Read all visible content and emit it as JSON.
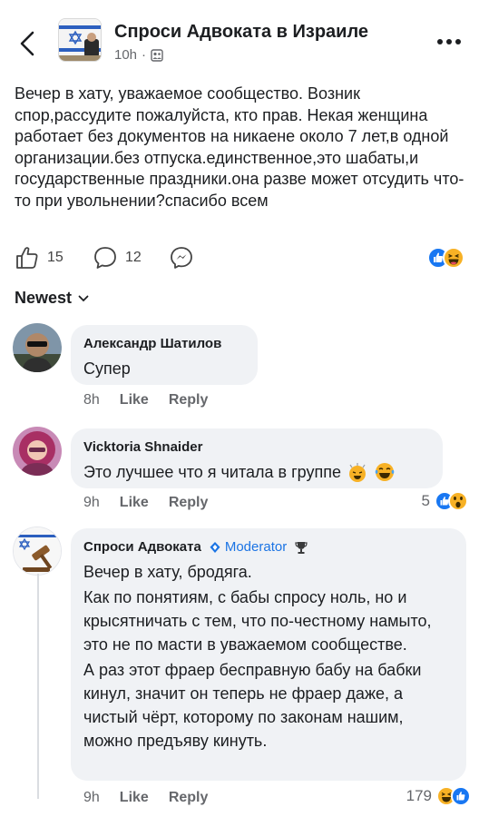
{
  "header": {
    "group_name": "Спроси Адвоката в Израиле",
    "time": "10h",
    "separator": "·",
    "back_icon": "chevron-left-icon",
    "more_icon": "more-horizontal-icon"
  },
  "post": {
    "text": "Вечер в хату, уважаемое сообщество. Возник спор,рассудите пожалуйста, кто прав. Некая женщина работает без документов на никаене около 7 лет,в одной организации.без отпуска.единственное,это шабаты,и государственные праздники.она разве может отсудить что-то при увольнении?спасибо всем",
    "likes": "15",
    "comments": "12"
  },
  "sort": {
    "label": "Newest"
  },
  "comments": [
    {
      "name": "Александр Шатилов",
      "text": "Супер",
      "time": "8h",
      "like": "Like",
      "reply": "Reply"
    },
    {
      "name": "Vicktoria Shnaider",
      "text": "Это лучшее что я читала в группе",
      "time": "9h",
      "like": "Like",
      "reply": "Reply",
      "reactions": "5"
    },
    {
      "name": "Спроси Адвоката",
      "badge": "Moderator",
      "lines": [
        "Вечер в хату, бродяга.",
        "Как по понятиям, с бабы спросу ноль, но и крысятничать с тем, что по-честному намыто, это не по масти в уважаемом сообществе.",
        "А раз этот фраер бесправную бабу на бабки кинул, значит он теперь не фраер даже, а чистый чёрт, которому по законам нашим, можно предъяву кинуть."
      ],
      "time": "9h",
      "like": "Like",
      "reply": "Reply",
      "reactions": "179"
    }
  ],
  "colors": {
    "accent": "#1b74e4",
    "bubble": "#f0f2f5",
    "meta": "#65676b",
    "like_blue": "#1877f2",
    "haha_yellow": "#f7b125"
  }
}
